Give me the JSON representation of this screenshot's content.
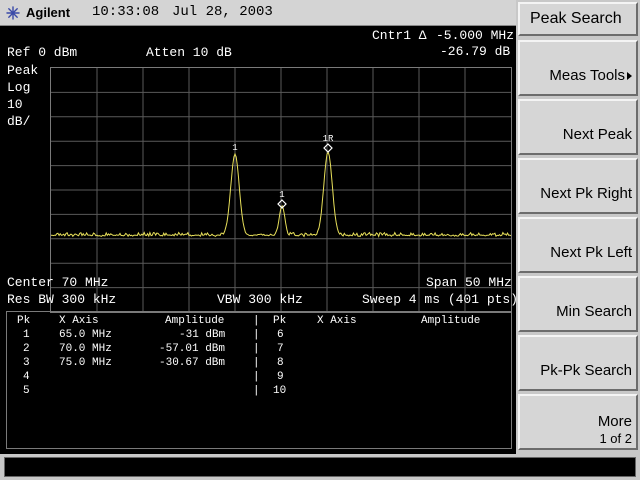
{
  "header": {
    "brand": "Agilent",
    "time": "10:33:08",
    "date": "Jul 28, 2003"
  },
  "display": {
    "marker_readout_label": "Cntr1 Δ",
    "marker_readout_freq": "-5.000 MHz",
    "marker_readout_amp": "-26.79 dB",
    "ref_level": "Ref 0 dBm",
    "atten": "Atten 10 dB",
    "detector": "Peak",
    "scale_type": "Log",
    "scale_value": "10",
    "scale_unit": "dB/",
    "center": "Center 70 MHz",
    "span": "Span 50 MHz",
    "res_bw": "Res BW 300 kHz",
    "vbw": "VBW 300 kHz",
    "sweep": "Sweep 4 ms (401 pts)",
    "trace_color": "#e8e05a",
    "marker_labels": {
      "m1": "1",
      "m1delta": "1",
      "m1ref": "1R"
    }
  },
  "marker_table": {
    "headers": [
      "Pk",
      "X Axis",
      "Amplitude",
      "|",
      "Pk",
      "X Axis",
      "Amplitude"
    ],
    "left_rows": [
      {
        "pk": "1",
        "x": "65.0 MHz",
        "amp": "-31 dBm"
      },
      {
        "pk": "2",
        "x": "70.0 MHz",
        "amp": "-57.01 dBm"
      },
      {
        "pk": "3",
        "x": "75.0 MHz",
        "amp": "-30.67 dBm"
      },
      {
        "pk": "4",
        "x": "",
        "amp": ""
      },
      {
        "pk": "5",
        "x": "",
        "amp": ""
      }
    ],
    "right_rows": [
      {
        "pk": "6"
      },
      {
        "pk": "7"
      },
      {
        "pk": "8"
      },
      {
        "pk": "9"
      },
      {
        "pk": "10"
      }
    ]
  },
  "softkeys": {
    "title": "Peak Search",
    "keys": [
      {
        "label": "Meas Tools",
        "sub": ""
      },
      {
        "label": "Next Peak",
        "sub": ""
      },
      {
        "label": "Next Pk Right",
        "sub": ""
      },
      {
        "label": "Next Pk Left",
        "sub": ""
      },
      {
        "label": "Min Search",
        "sub": ""
      },
      {
        "label": "Pk-Pk Search",
        "sub": ""
      },
      {
        "label": "More",
        "sub": "1 of 2"
      }
    ]
  }
}
